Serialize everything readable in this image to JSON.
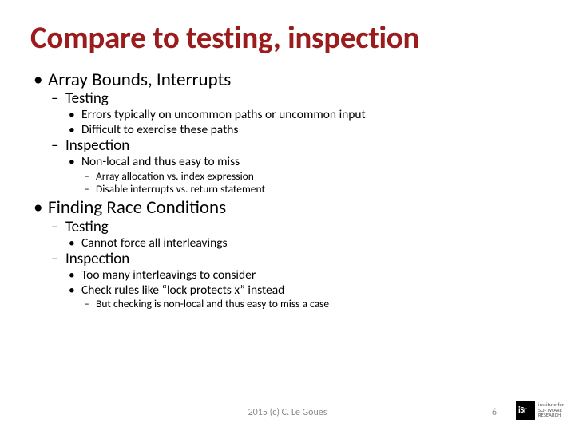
{
  "title": "Compare to testing, inspection",
  "bullets": {
    "b1": "Array Bounds, Interrupts",
    "b1a": "Testing",
    "b1a1": "Errors typically on uncommon paths or uncommon input",
    "b1a2": "Difficult to exercise these paths",
    "b1b": "Inspection",
    "b1b1": "Non-local and thus easy to miss",
    "b1b1a": "Array allocation vs. index expression",
    "b1b1b": "Disable interrupts vs. return statement",
    "b2": "Finding Race Conditions",
    "b2a": "Testing",
    "b2a1": "Cannot force all interleavings",
    "b2b": "Inspection",
    "b2b1": "Too many interleavings to consider",
    "b2b2": "Check rules like “lock protects x” instead",
    "b2b2a": "But checking is non-local and thus easy to miss a case"
  },
  "footer": {
    "copyright": "2015 (c) C. Le Goues",
    "page": "6",
    "logo_line1": "institute for",
    "logo_line2": "SOFTWARE",
    "logo_line3": "RESEARCH"
  }
}
